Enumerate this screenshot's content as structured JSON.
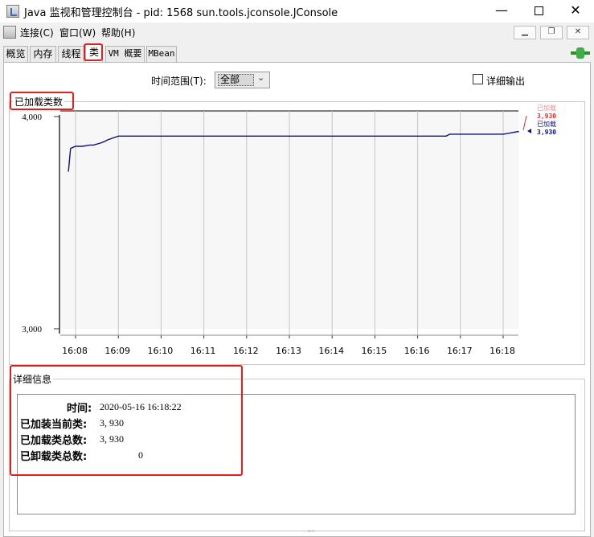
{
  "window": {
    "title": "Java 监视和管理控制台 - pid: 1568 sun.tools.jconsole.JConsole",
    "minimize": "—",
    "close": "✕"
  },
  "menu": {
    "items": [
      "连接(C)",
      "窗口(W)",
      "帮助(H)"
    ],
    "mdi_minimize": "▁",
    "mdi_restore": "❐",
    "mdi_close": "✕"
  },
  "tabs": [
    "概览",
    "内存",
    "线程",
    "类",
    "VM 概要",
    "MBean"
  ],
  "active_tab": "类",
  "time_range": {
    "label": "时间范围(T):",
    "value": "全部",
    "arrow": "⌄"
  },
  "detail_output": {
    "label": "详细输出",
    "checked": false
  },
  "chart_data": {
    "type": "line",
    "title": "已加载类数",
    "ylim": [
      3000,
      4000
    ],
    "y_ticks": [
      "4,000",
      "3,000"
    ],
    "x_ticks": [
      "16:08",
      "16:09",
      "16:10",
      "16:11",
      "16:12",
      "16:13",
      "16:14",
      "16:15",
      "16:16",
      "16:17",
      "16:18"
    ],
    "grid": true,
    "legend": {
      "placement": "right",
      "entries": [
        {
          "name": "已加载",
          "value": "3,930",
          "color": "#e03030"
        },
        {
          "name": "已加载",
          "value": "3,930",
          "color": "#101080"
        }
      ]
    },
    "series": [
      {
        "name": "已加载",
        "color": "#101080",
        "x": [
          "16:07:50",
          "16:07:53",
          "16:08:00",
          "16:08:10",
          "16:08:15",
          "16:08:20",
          "16:08:25",
          "16:08:35",
          "16:08:40",
          "16:08:45",
          "16:09:00",
          "16:16:40",
          "16:16:45",
          "16:17:00",
          "16:18:00",
          "16:18:22"
        ],
        "values": [
          3740,
          3850,
          3860,
          3860,
          3863,
          3866,
          3866,
          3875,
          3882,
          3890,
          3908,
          3908,
          3917,
          3917,
          3917,
          3930
        ]
      }
    ]
  },
  "details": {
    "title": "详细信息",
    "rows": [
      {
        "label": "时间:",
        "value": "2020-05-16 16:18:22"
      },
      {
        "label": "已加装当前类:",
        "value": "3, 930"
      },
      {
        "label": "已加载类总数:",
        "value": "3, 930"
      },
      {
        "label": "已卸载类总数:",
        "value": "0"
      }
    ]
  },
  "colors": {
    "highlight": "#e02020",
    "series": "#101080",
    "legend_other": "#e03030"
  }
}
